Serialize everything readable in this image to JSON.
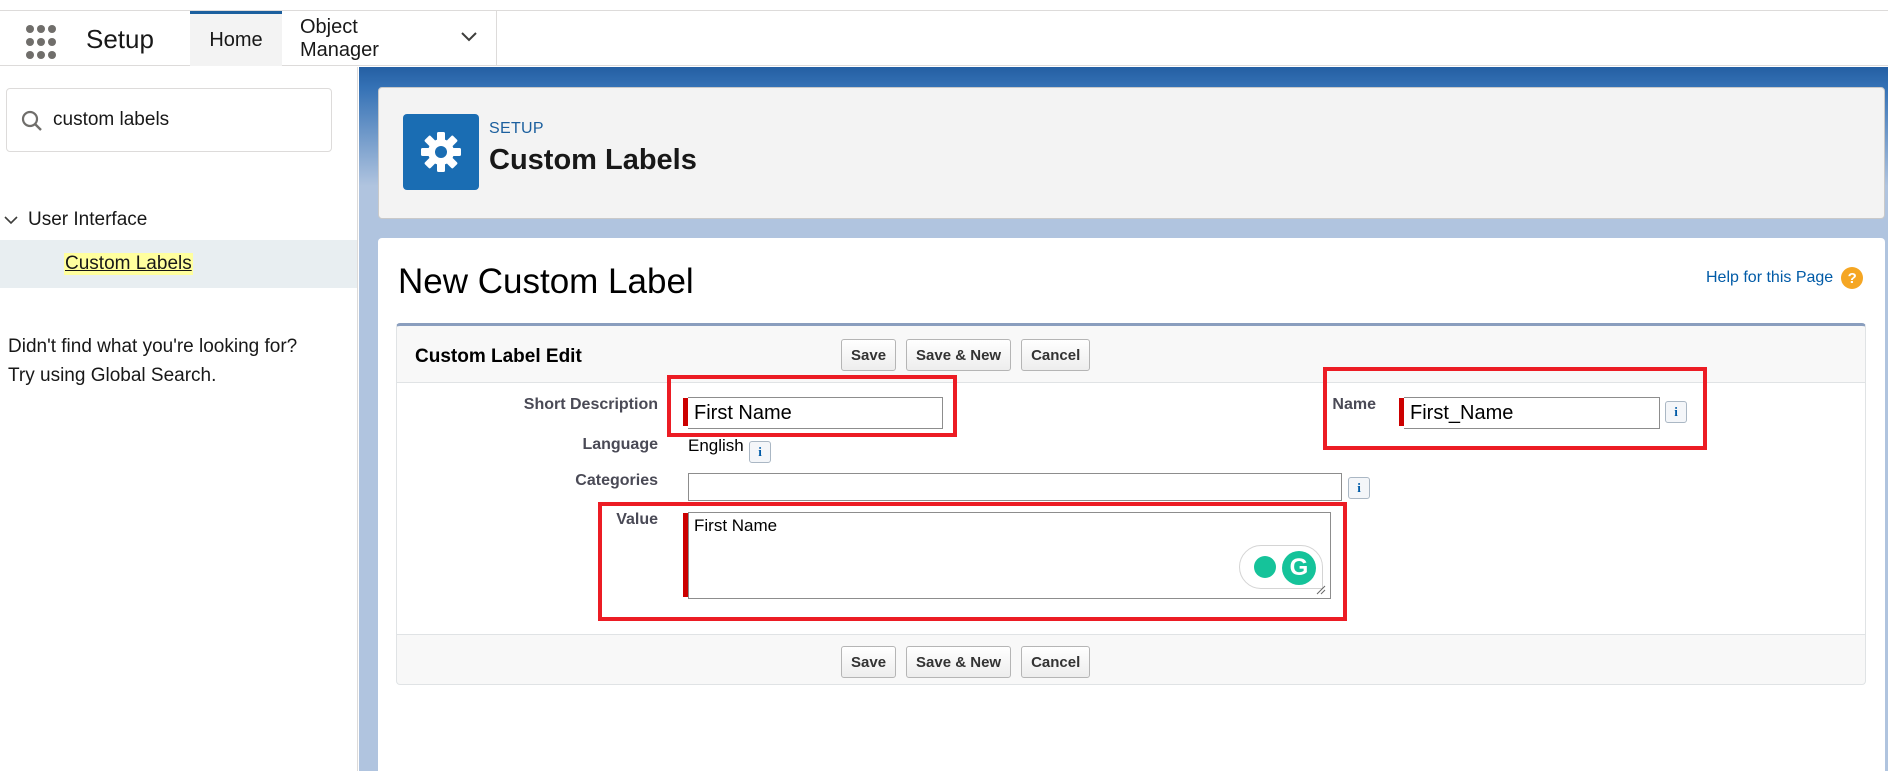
{
  "app": {
    "name": "Setup"
  },
  "nav": {
    "tabs": [
      {
        "label": "Home",
        "active": true
      },
      {
        "label": "Object Manager",
        "has_dropdown": true
      }
    ]
  },
  "sidebar": {
    "search_value": "custom labels",
    "tree": {
      "group_label": "User Interface",
      "item_label": "Custom Labels"
    },
    "not_found_line1": "Didn't find what you're looking for?",
    "not_found_line2": "Try using Global Search."
  },
  "header": {
    "breadcrumb": "SETUP",
    "title": "Custom Labels",
    "icon": "gear-icon"
  },
  "page": {
    "heading": "New Custom Label",
    "help_link": "Help for this Page"
  },
  "form": {
    "section_title": "Custom Label Edit",
    "buttons": {
      "save": "Save",
      "save_new": "Save & New",
      "cancel": "Cancel"
    },
    "fields": {
      "short_description": {
        "label": "Short Description",
        "value": "First Name",
        "required": true
      },
      "name": {
        "label": "Name",
        "value": "First_Name",
        "required": true
      },
      "language": {
        "label": "Language",
        "value": "English"
      },
      "categories": {
        "label": "Categories",
        "value": ""
      },
      "value": {
        "label": "Value",
        "value": "First Name",
        "required": true
      }
    }
  },
  "colors": {
    "brand_blue": "#1a6db3",
    "required_red": "#c00",
    "highlight_red": "#ec1c24",
    "grammarly_green": "#15c39a"
  }
}
